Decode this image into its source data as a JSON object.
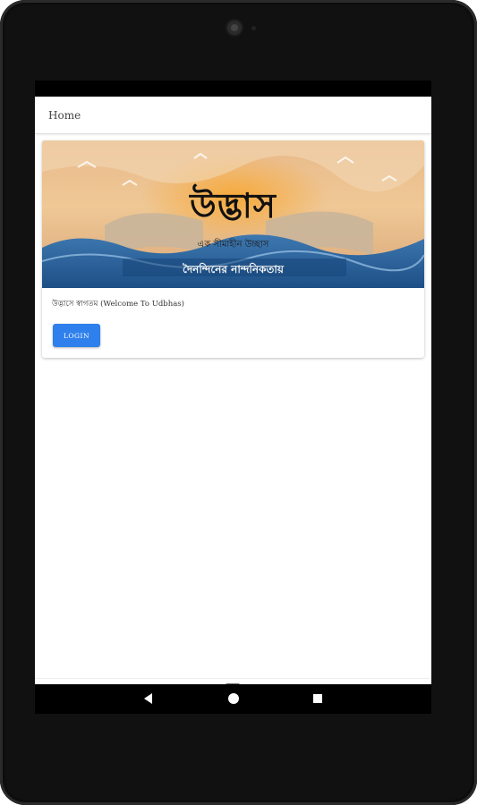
{
  "header": {
    "title": "Home"
  },
  "banner": {
    "brand": "উদ্ভাস",
    "tagline": "এক সীমাহীন উচ্ছাস",
    "slogan": "দৈনন্দিনের নান্দনিকতায়"
  },
  "card": {
    "welcome_text": "উদ্ভাসে স্বাগতম (Welcome To Udbhas)",
    "login_label": "LOGIN"
  },
  "tabbar": {
    "tabs": [
      {
        "icon": "store-icon",
        "active": true
      },
      {
        "icon": "book-icon",
        "active": false
      },
      {
        "icon": "cart-icon",
        "active": false
      }
    ]
  },
  "navbar": {
    "icons": [
      "back-icon",
      "home-icon",
      "recents-icon"
    ]
  },
  "colors": {
    "accent": "#2f80ed",
    "tab_icon": "#3f6fd8",
    "tab_icon_muted": "#666666"
  }
}
